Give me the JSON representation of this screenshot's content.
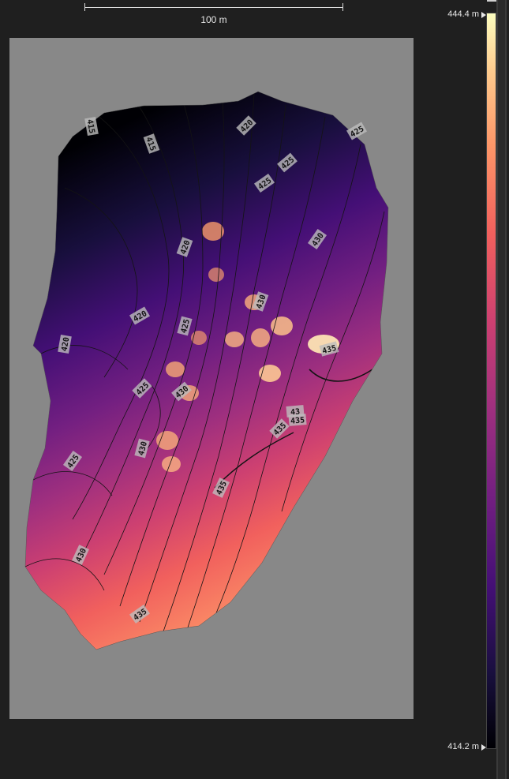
{
  "scale_bar": {
    "label": "100 m"
  },
  "legend": {
    "max_label": "444.4 m",
    "min_label": "414.2 m",
    "colormap": "magma",
    "colors": [
      "#000004",
      "#180f3d",
      "#440f76",
      "#721f81",
      "#9e2f7f",
      "#cd4071",
      "#f1605d",
      "#fd9668",
      "#feca8d",
      "#fcfdbf"
    ]
  },
  "map": {
    "background_color": "#888888",
    "contour_labels": [
      "415",
      "415",
      "420",
      "425",
      "425",
      "425",
      "420",
      "430",
      "420",
      "425",
      "430",
      "420",
      "425",
      "430",
      "435",
      "425",
      "430",
      "43",
      "435",
      "435",
      "435",
      "425",
      "430",
      "435",
      "435"
    ]
  }
}
